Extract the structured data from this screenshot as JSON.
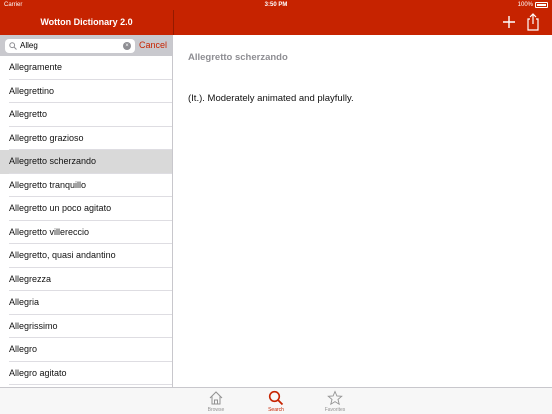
{
  "status_bar": {
    "carrier": "Carrier",
    "time": "3:50 PM",
    "battery": "100%"
  },
  "navbar": {
    "title": "Wotton Dictionary 2.0",
    "add_icon": "plus-icon",
    "share_icon": "share-icon"
  },
  "search": {
    "value": "Alleg",
    "cancel_label": "Cancel"
  },
  "results": [
    "Allegramente",
    "Allegrettino",
    "Allegretto",
    "Allegretto grazioso",
    "Allegretto scherzando",
    "Allegretto tranquillo",
    "Allegretto un poco agitato",
    "Allegretto villereccio",
    "Allegretto, quasi andantino",
    "Allegrezza",
    "Allegria",
    "Allegrissimo",
    "Allegro",
    "Allegro agitato"
  ],
  "selected_index": 4,
  "detail": {
    "title": "Allegretto scherzando",
    "definition": "(It.). Moderately animated and playfully."
  },
  "tabs": [
    {
      "label": "Browse",
      "icon": "house-icon"
    },
    {
      "label": "Search",
      "icon": "search-icon"
    },
    {
      "label": "Favorites",
      "icon": "star-icon"
    }
  ],
  "colors": {
    "accent": "#c62300",
    "selected_row": "#d9d9d9",
    "inactive_tab": "#929292"
  }
}
